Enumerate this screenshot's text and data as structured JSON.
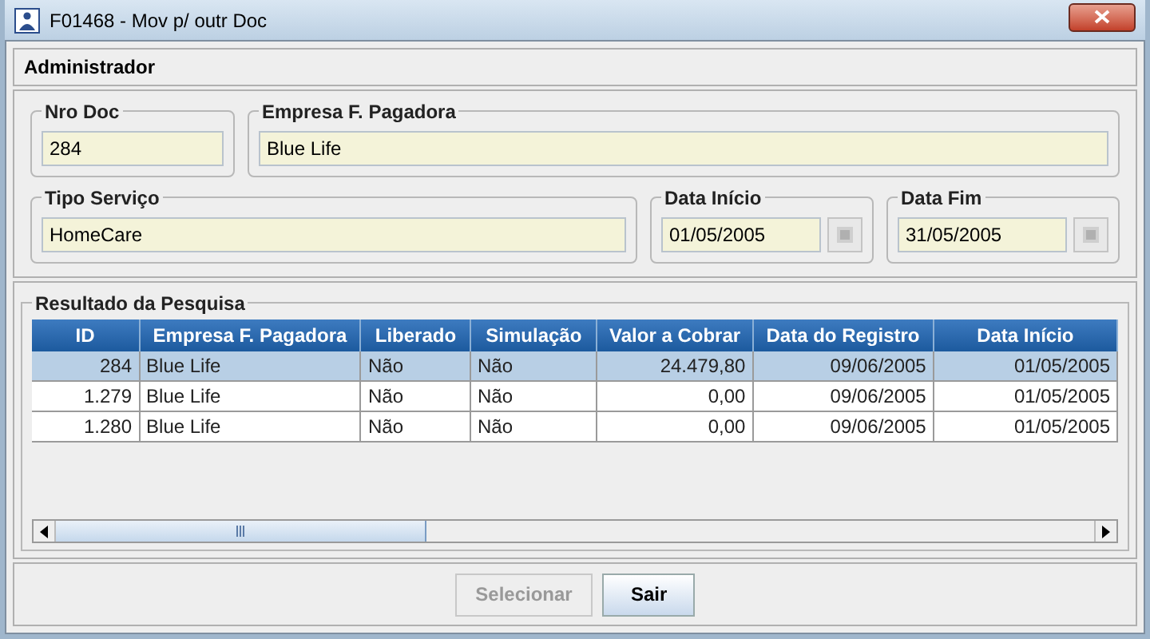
{
  "window": {
    "title": "F01468 - Mov p/ outr Doc"
  },
  "header": "Administrador",
  "fields": [
    {
      "label": "Nro Doc",
      "value": "284",
      "kind": "text"
    },
    {
      "label": "Empresa F. Pagadora",
      "value": "Blue Life",
      "kind": "text"
    },
    {
      "label": "Tipo Serviço",
      "value": "HomeCare",
      "kind": "text"
    },
    {
      "label": "Data Início",
      "value": "01/05/2005",
      "kind": "date"
    },
    {
      "label": "Data Fim",
      "value": "31/05/2005",
      "kind": "date"
    }
  ],
  "results": {
    "title": "Resultado da Pesquisa",
    "columns": [
      "ID",
      "Empresa F. Pagadora",
      "Liberado",
      "Simulação",
      "Valor a Cobrar",
      "Data do Registro",
      "Data Início"
    ],
    "rows": [
      {
        "selected": true,
        "cells": [
          "284",
          "Blue Life",
          "Não",
          "Não",
          "24.479,80",
          "09/06/2005",
          "01/05/2005"
        ]
      },
      {
        "selected": false,
        "cells": [
          "1.279",
          "Blue Life",
          "Não",
          "Não",
          "0,00",
          "09/06/2005",
          "01/05/2005"
        ]
      },
      {
        "selected": false,
        "cells": [
          "1.280",
          "Blue Life",
          "Não",
          "Não",
          "0,00",
          "09/06/2005",
          "01/05/2005"
        ]
      }
    ]
  },
  "buttons": [
    {
      "label": "Selecionar",
      "disabled": true
    },
    {
      "label": "Sair",
      "disabled": false
    }
  ]
}
